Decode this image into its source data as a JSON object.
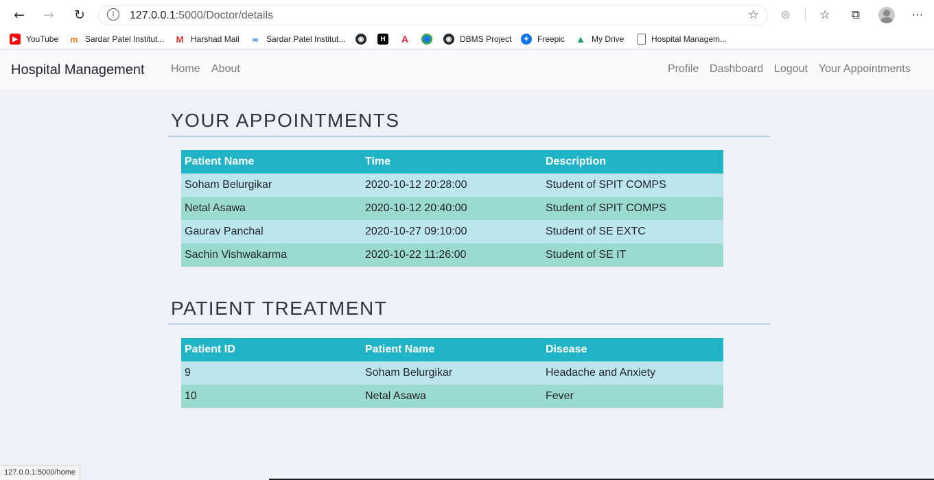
{
  "browser": {
    "url_host": "127.0.0.1",
    "url_path": ":5000/Doctor/details",
    "status_url": "127.0.0.1:5000/home"
  },
  "bookmarks": [
    {
      "label": "YouTube",
      "icon": "youtube-icon",
      "color": "#ff0000"
    },
    {
      "label": "Sardar Patel Institut...",
      "icon": "moodle-icon",
      "color": "#f98012"
    },
    {
      "label": "Harshad Mail",
      "icon": "gmail-icon",
      "color": "#d93025"
    },
    {
      "label": "Sardar Patel Institut...",
      "icon": "link-icon",
      "color": "#1a73e8"
    },
    {
      "label": "",
      "icon": "github-icon",
      "color": "#24292e"
    },
    {
      "label": "",
      "icon": "hackerrank-icon",
      "color": "#000000"
    },
    {
      "label": "",
      "icon": "adobe-icon",
      "color": "#ed1c24"
    },
    {
      "label": "",
      "icon": "chrome-like-icon",
      "color": "#1a73e8"
    },
    {
      "label": "DBMS Project",
      "icon": "github-icon",
      "color": "#24292e"
    },
    {
      "label": "Freepic",
      "icon": "freepik-icon",
      "color": "#1273eb"
    },
    {
      "label": "My Drive",
      "icon": "google-drive-icon",
      "color": "#0f9d58"
    },
    {
      "label": "Hospital Managem...",
      "icon": "page-icon",
      "color": "#5f6368"
    }
  ],
  "navbar": {
    "brand": "Hospital Management",
    "left_links": [
      "Home",
      "About"
    ],
    "right_links": [
      "Profile",
      "Dashboard",
      "Logout",
      "Your Appointments"
    ]
  },
  "appointments": {
    "title": "YOUR APPOINTMENTS",
    "headers": [
      "Patient Name",
      "Time",
      "Description"
    ],
    "rows": [
      [
        "Soham Belurgikar",
        "2020-10-12 20:28:00",
        "Student of SPIT COMPS"
      ],
      [
        "Netal Asawa",
        "2020-10-12 20:40:00",
        "Student of SPIT COMPS"
      ],
      [
        "Gaurav Panchal",
        "2020-10-27 09:10:00",
        "Student of SE EXTC"
      ],
      [
        "Sachin Vishwakarma",
        "2020-10-22 11:26:00",
        "Student of SE IT"
      ]
    ]
  },
  "treatment": {
    "title": "PATIENT TREATMENT",
    "headers": [
      "Patient ID",
      "Patient Name",
      "Disease"
    ],
    "rows": [
      [
        "9",
        "Soham Belurgikar",
        "Headache and Anxiety"
      ],
      [
        "10",
        "Netal Asawa",
        "Fever"
      ]
    ]
  },
  "colors": {
    "table_header": "#20b4c6",
    "row_odd": "#bde6ec",
    "row_even": "#9bdad0",
    "title_rule": "#6d9fd8"
  }
}
